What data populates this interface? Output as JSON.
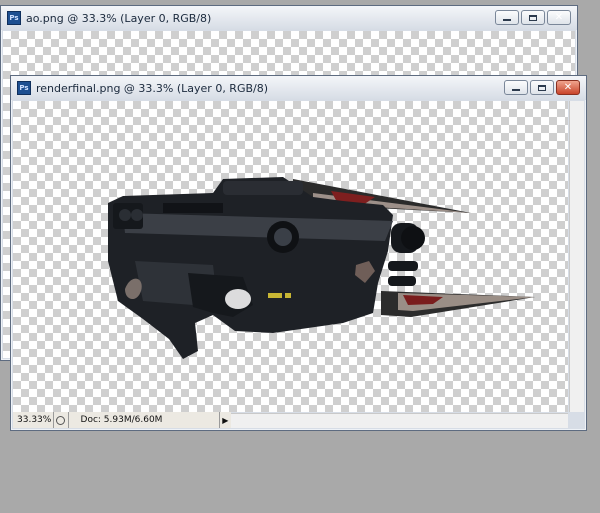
{
  "windows": {
    "back": {
      "title": "ao.png @ 33.3% (Layer 0, RGB/8)"
    },
    "front": {
      "title": "renderfinal.png @ 33.3% (Layer 0, RGB/8)",
      "status": {
        "zoom": "33.33%",
        "doc": "Doc: 5.93M/6.60M",
        "menu_arrow": "▶"
      }
    }
  },
  "icons": [
    "ps-icon",
    "minimize-icon",
    "maximize-icon",
    "close-icon",
    "status-icon",
    "menu-arrow-icon"
  ],
  "colors": {
    "desktop": "#a9a9a9",
    "window_frame": "#d7dde6",
    "close_button": "#c8442a"
  }
}
